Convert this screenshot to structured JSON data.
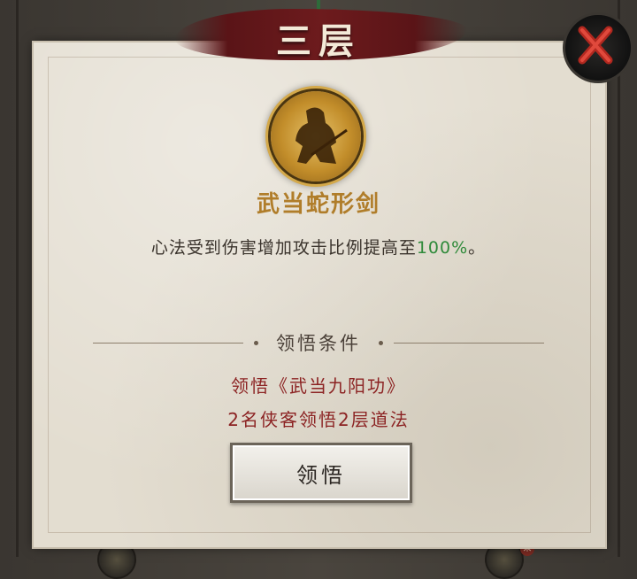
{
  "panel": {
    "title": "三层",
    "corner_tag": "未"
  },
  "skill": {
    "name": "武当蛇形剑",
    "description_prefix": "心法受到伤害增加攻击比例提高至",
    "description_value": "100%",
    "description_suffix": "。"
  },
  "requirements": {
    "header": "领悟条件",
    "items": [
      "领悟《武当九阳功》",
      "2名侠客领悟2层道法"
    ]
  },
  "button": {
    "label": "领悟"
  },
  "colors": {
    "skill_name": "#b07d2a",
    "highlight_value": "#2f8a3a",
    "requirement_text": "#8c2323",
    "banner": "#6d1b1d"
  },
  "icons": {
    "close": "close-x-icon",
    "emblem": "swordsman-emblem-icon"
  }
}
